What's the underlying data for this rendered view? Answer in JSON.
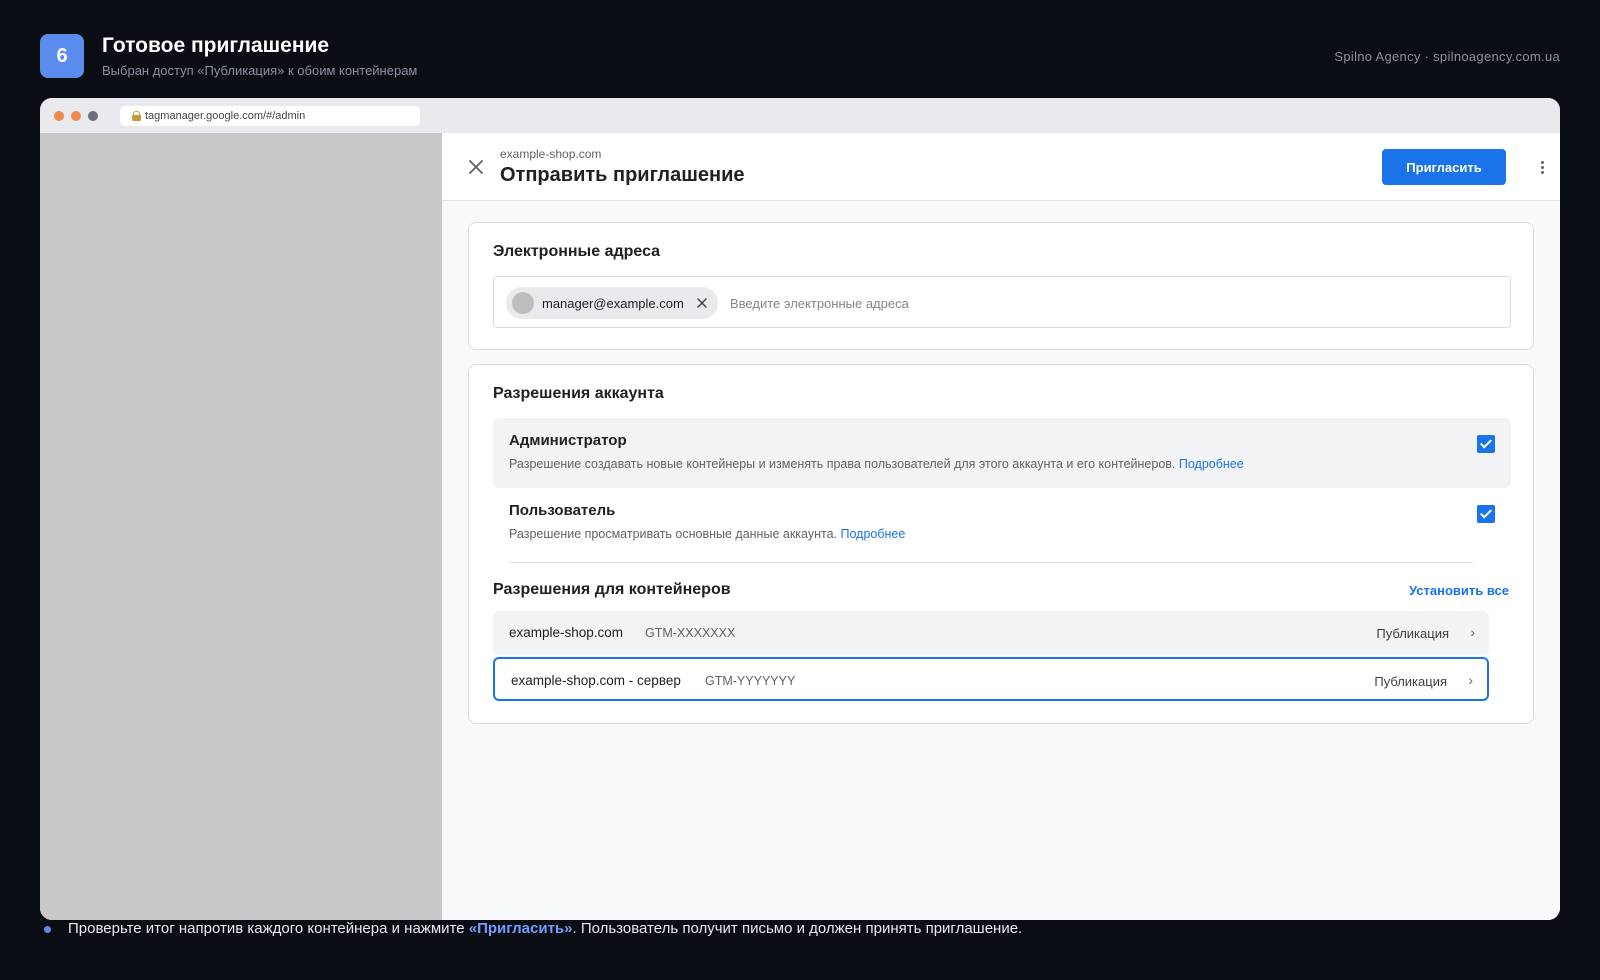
{
  "step": {
    "number": "6",
    "title": "Готовое приглашение",
    "subtitle": "Выбран доступ «Публикация» к обоим контейнерам"
  },
  "brand": "Spilno Agency · spilnoagency.com.ua",
  "browser": {
    "url": "tagmanager.google.com/#/admin"
  },
  "dialog": {
    "domain": "example-shop.com",
    "title": "Отправить приглашение",
    "invite_label": "Пригласить"
  },
  "emails": {
    "title": "Электронные адреса",
    "chip": "manager@example.com",
    "placeholder": "Введите электронные адреса"
  },
  "account_permissions": {
    "title": "Разрешения аккаунта",
    "admin": {
      "name": "Администратор",
      "desc": "Разрешение создавать новые контейнеры и изменять права пользователей для этого аккаунта и его контейнеров.",
      "link": "Подробнее",
      "checked": true
    },
    "user": {
      "name": "Пользователь",
      "desc": "Разрешение просматривать основные данные аккаунта.",
      "link": "Подробнее",
      "checked": true
    }
  },
  "container_permissions": {
    "title": "Разрешения для контейнеров",
    "set_all": "Установить все",
    "rows": [
      {
        "name": "example-shop.com",
        "id": "GTM-XXXXXXX",
        "role": "Публикация"
      },
      {
        "name": "example-shop.com - сервер",
        "id": "GTM-YYYYYYY",
        "role": "Публикация"
      }
    ]
  },
  "note": {
    "before": "Проверьте итог напротив каждого контейнера и нажмите ",
    "highlight": "«Пригласить»",
    "after": ". Пользователь получит письмо и должен принять приглашение."
  },
  "colors": {
    "accent": "#1a73e8",
    "badge": "#5b8def",
    "background": "#0b0d14"
  }
}
